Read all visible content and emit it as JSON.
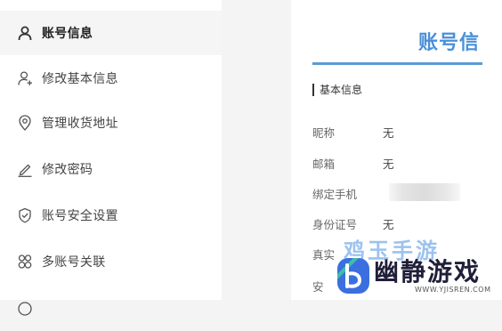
{
  "sidebar": {
    "items": [
      {
        "label": "账号信息",
        "icon": "user-icon",
        "active": true
      },
      {
        "label": "修改基本信息",
        "icon": "user-plus-icon",
        "active": false
      },
      {
        "label": "管理收货地址",
        "icon": "location-pin-icon",
        "active": false
      },
      {
        "label": "修改密码",
        "icon": "pencil-icon",
        "active": false
      },
      {
        "label": "账号安全设置",
        "icon": "shield-check-icon",
        "active": false
      },
      {
        "label": "多账号关联",
        "icon": "link-accounts-icon",
        "active": false
      }
    ]
  },
  "main": {
    "page_title": "账号信",
    "section_title": "基本信息",
    "fields": [
      {
        "label": "昵称",
        "value": "无"
      },
      {
        "label": "邮箱",
        "value": "无"
      },
      {
        "label": "绑定手机",
        "value": ""
      },
      {
        "label": "身份证号",
        "value": "无"
      },
      {
        "label": "真实",
        "value": ""
      },
      {
        "label": "安",
        "value": ""
      }
    ]
  },
  "watermark": {
    "top_text": "鸡玉手游",
    "brand": "幽静游戏",
    "url": "WWW.YJISREN.COM"
  },
  "colors": {
    "accent": "#4a90d9",
    "underline": "#5b9bd5",
    "active_bg": "#f5f5f5",
    "logo_green": "#3fc6a3",
    "logo_blue": "#3b6fe0"
  }
}
